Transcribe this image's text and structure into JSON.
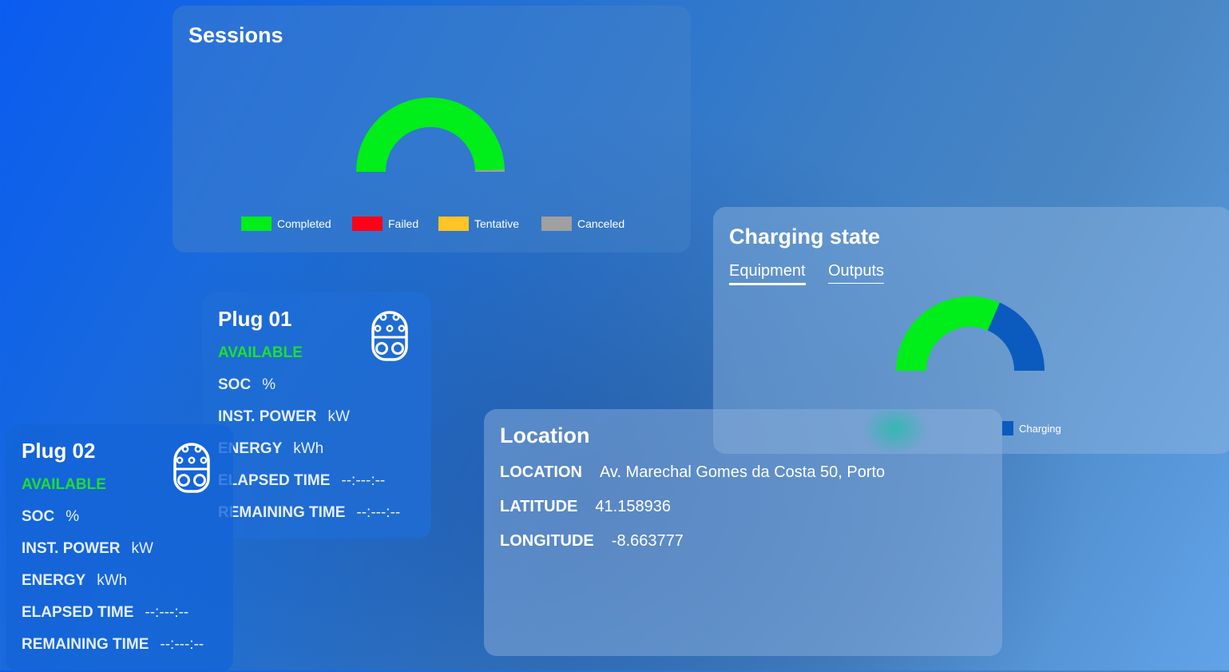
{
  "sessions": {
    "title": "Sessions",
    "gauge": {
      "completed": 0.99,
      "failed": 0.0,
      "tentative": 0.0,
      "canceled": 0.01
    },
    "legend": [
      {
        "label": "Completed",
        "color": "#00ee1a"
      },
      {
        "label": "Failed",
        "color": "#ff0018"
      },
      {
        "label": "Tentative",
        "color": "#ffc425"
      },
      {
        "label": "Canceled",
        "color": "#a0a0a0"
      }
    ]
  },
  "charging_state": {
    "title": "Charging state",
    "tabs": [
      {
        "label": "Equipment",
        "active": true
      },
      {
        "label": "Outputs",
        "active": false
      }
    ],
    "gauge": {
      "available": 0.63,
      "charging": 0.37,
      "available_color": "#00ee1a",
      "charging_color": "#0a5bbd"
    },
    "legend": [
      {
        "label": "Charging",
        "color": "#0a5bbd"
      }
    ]
  },
  "plug01": {
    "title": "Plug 01",
    "status": "AVAILABLE",
    "rows": [
      {
        "label": "SOC",
        "value": "%"
      },
      {
        "label": "INST. POWER",
        "value": "kW"
      },
      {
        "label": "ENERGY",
        "value": "kWh"
      },
      {
        "label": "ELAPSED TIME",
        "value": "--:---:--"
      },
      {
        "label": "REMAINING TIME",
        "value": "--:---:--"
      }
    ]
  },
  "plug02": {
    "title": "Plug 02",
    "status": "AVAILABLE",
    "rows": [
      {
        "label": "SOC",
        "value": "%"
      },
      {
        "label": "INST. POWER",
        "value": "kW"
      },
      {
        "label": "ENERGY",
        "value": "kWh"
      },
      {
        "label": "ELAPSED TIME",
        "value": "--:---:--"
      },
      {
        "label": "REMAINING TIME",
        "value": "--:---:--"
      }
    ]
  },
  "location": {
    "title": "Location",
    "rows": [
      {
        "label": "LOCATION",
        "value": "Av. Marechal Gomes da Costa 50, Porto"
      },
      {
        "label": "LATITUDE",
        "value": "41.158936"
      },
      {
        "label": "LONGITUDE",
        "value": "-8.663777"
      }
    ]
  }
}
